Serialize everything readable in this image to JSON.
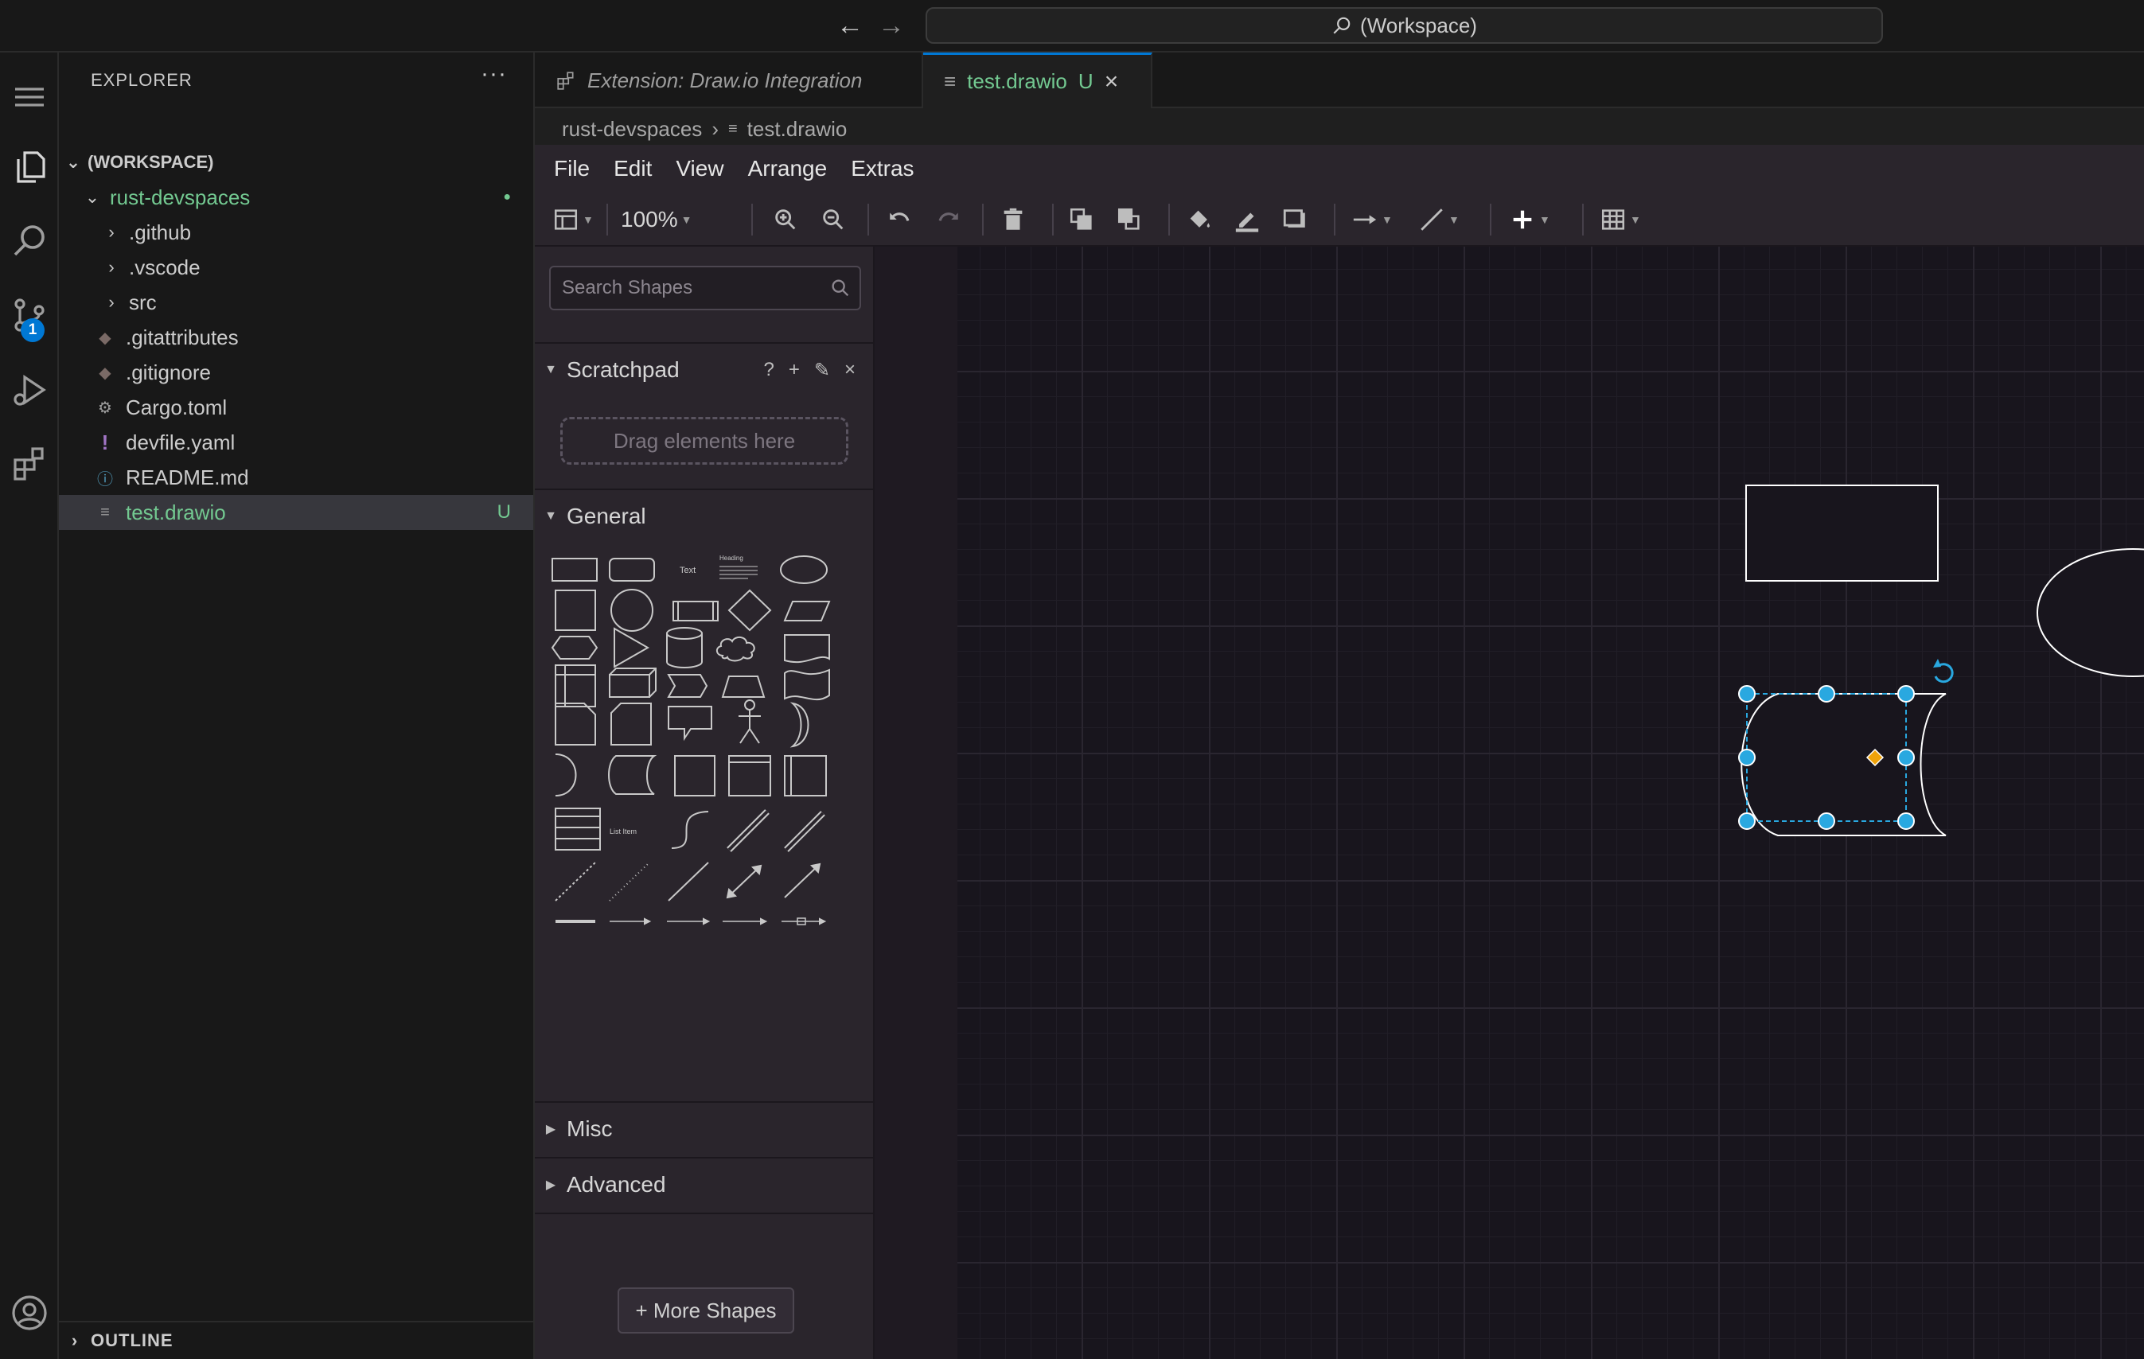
{
  "titlebar": {
    "search_text": "(Workspace)",
    "back_icon": "arrow-left-icon",
    "forward_icon": "arrow-right-icon"
  },
  "activitybar": {
    "items": [
      {
        "name": "explorer",
        "icon": "files-icon"
      },
      {
        "name": "search",
        "icon": "search-icon"
      },
      {
        "name": "source-control",
        "icon": "source-control-icon",
        "badge": "1"
      },
      {
        "name": "run-debug",
        "icon": "run-debug-icon"
      },
      {
        "name": "extensions",
        "icon": "extensions-icon"
      }
    ],
    "account_icon": "account-icon"
  },
  "sidebar": {
    "title": "EXPLORER",
    "more": "···",
    "workspace_label": "(WORKSPACE)",
    "tree": [
      {
        "label": "rust-devspaces",
        "type": "folder-open",
        "color": "#73c991",
        "trail": "●"
      },
      {
        "label": ".github",
        "type": "folder"
      },
      {
        "label": ".vscode",
        "type": "folder"
      },
      {
        "label": "src",
        "type": "folder"
      },
      {
        "label": ".gitattributes",
        "type": "file",
        "icon": "git-icon"
      },
      {
        "label": ".gitignore",
        "type": "file",
        "icon": "git-icon"
      },
      {
        "label": "Cargo.toml",
        "type": "file",
        "icon": "gear-icon"
      },
      {
        "label": "devfile.yaml",
        "type": "file",
        "icon": "exclamation-icon"
      },
      {
        "label": "README.md",
        "type": "file",
        "icon": "info-icon"
      },
      {
        "label": "test.drawio",
        "type": "file",
        "icon": "lines-icon",
        "color": "#73c991",
        "trail": "U",
        "selected": true
      }
    ],
    "outline_label": "OUTLINE"
  },
  "editor": {
    "tabs": [
      {
        "label": "Extension: Draw.io Integration"
      },
      {
        "label": "test.drawio",
        "status": "U",
        "close": "×"
      }
    ],
    "breadcrumb": [
      "rust-devspaces",
      "test.drawio"
    ]
  },
  "drawio": {
    "menus": [
      "File",
      "Edit",
      "View",
      "Arrange",
      "Extras"
    ],
    "zoom": "100%",
    "search_placeholder": "Search Shapes",
    "sections": {
      "scratchpad": "Scratchpad",
      "scratchpad_tools": [
        "?",
        "+",
        "✎",
        "×"
      ],
      "dropzone": "Drag elements here",
      "general": "General",
      "misc": "Misc",
      "advanced": "Advanced"
    },
    "shape_labels": {
      "text": "Text",
      "heading": "Heading",
      "list_item": "List Item"
    },
    "more_shapes": "+ More Shapes",
    "colors": {
      "accent": "#29a8e0",
      "handle_center": "#f0a30a",
      "shape_fill": "#18151d",
      "shape_stroke": "#ffffff"
    }
  }
}
